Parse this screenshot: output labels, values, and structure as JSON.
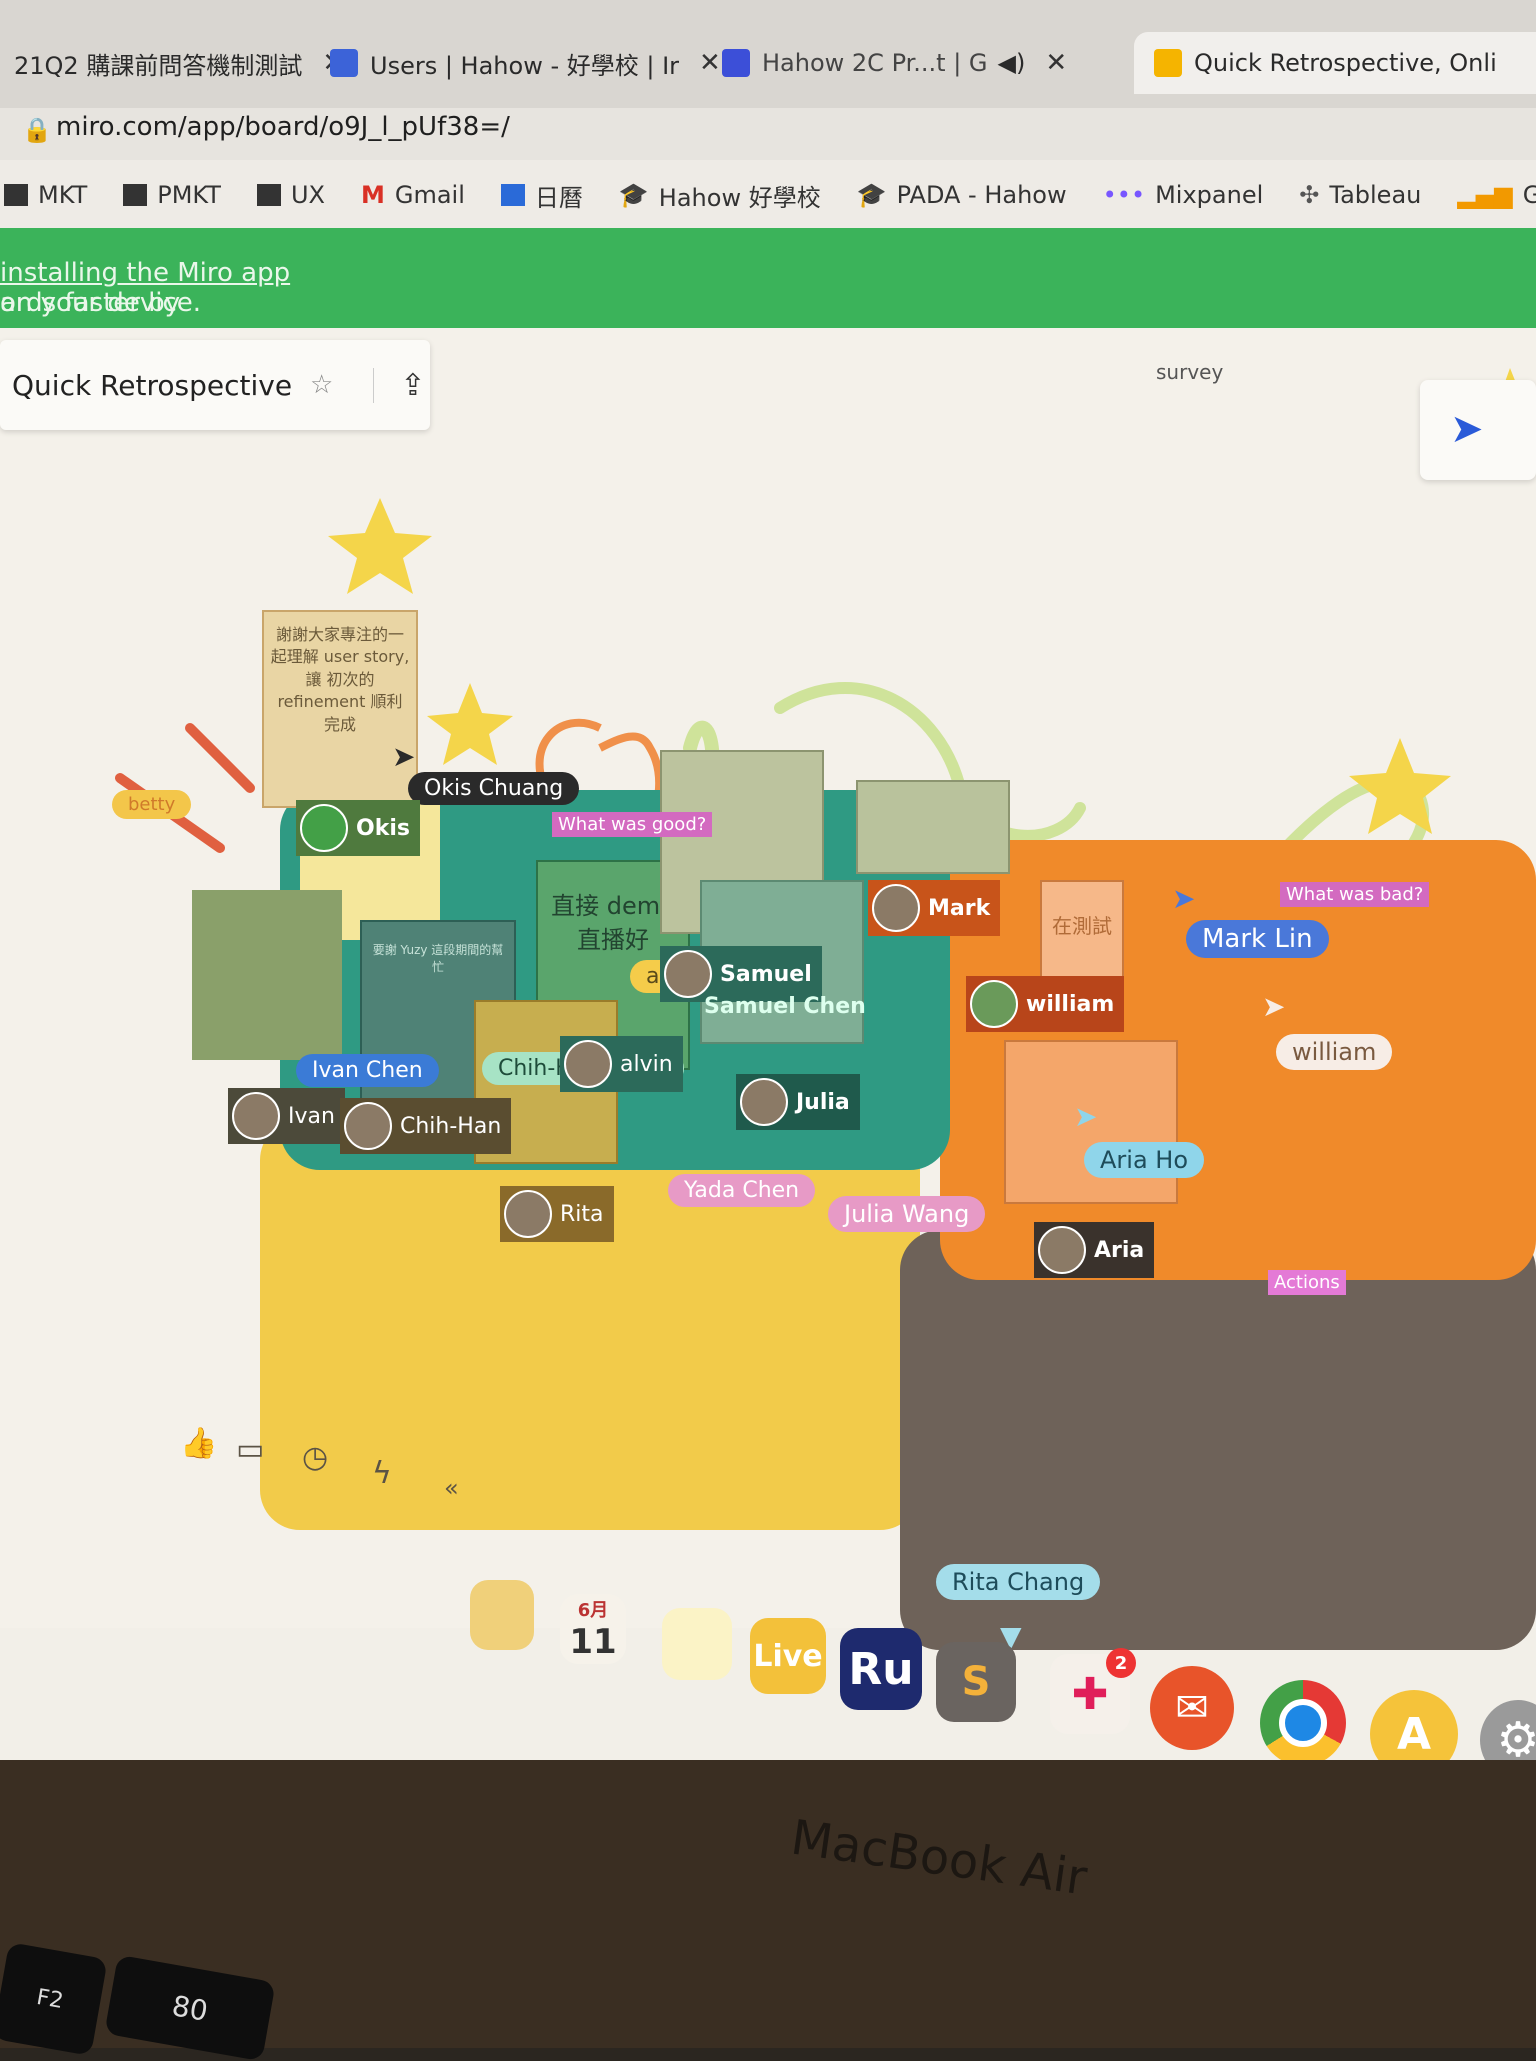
{
  "browser": {
    "tabs": [
      {
        "title": "21Q2 購課前問答機制測試"
      },
      {
        "title": "Users | Hahow - 好學校 | Ir"
      },
      {
        "title": "Hahow 2C Pr...t | G"
      },
      {
        "title": "Quick Retrospective, Onli"
      }
    ],
    "url": "miro.com/app/board/o9J_l_pUf38=/",
    "bookmarks": [
      "MKT",
      "PMKT",
      "UX",
      "Gmail",
      "日曆",
      "Hahow 好學校",
      "PADA - Hahow",
      "Mixpanel",
      "Tableau",
      "GA"
    ]
  },
  "banner": {
    "prefix": "ards faster by ",
    "link": "installing the Miro app",
    "suffix": " on your device."
  },
  "board": {
    "title": "Quick Retrospective",
    "survey_text": "survey",
    "sticky_top": "謝謝大家專注的一起理解 user story,讓 初次的 refinement 順利完成",
    "sticky_demo": "直接 demo 直播好",
    "sticky_testing": "在測試",
    "sticky_note_small": "要謝 Yuzy 這段期間的幫忙",
    "frame_labels": {
      "good": "What was good?",
      "bad": "What was bad?",
      "actions": "Actions"
    },
    "betty_label": "betty",
    "cursors": [
      {
        "name": "Okis Chuang",
        "color": "#2a2a2a"
      },
      {
        "name": "alvin",
        "color": "#f5cc4a"
      },
      {
        "name": "Ivan Chen",
        "color": "#3b7bd6"
      },
      {
        "name": "Chih-Han Wang",
        "color": "#a7e3c5"
      },
      {
        "name": "Mark Lin",
        "color": "#4a78d9"
      },
      {
        "name": "william",
        "color": "#f7ede6"
      },
      {
        "name": "Aria Ho",
        "color": "#8fd5ea"
      },
      {
        "name": "Yada Chen",
        "color": "#e79ac6"
      },
      {
        "name": "Julia Wang",
        "color": "#e79ac6"
      },
      {
        "name": "Rita Chang",
        "color": "#a4ddea"
      }
    ],
    "avatars": [
      "Okis",
      "Mark",
      "Samuel",
      "Samuel Chen",
      "Julia",
      "william",
      "Aria",
      "Ivan",
      "Chih-Han",
      "Rita",
      "alvin"
    ]
  },
  "dock": {
    "calendar_month": "6月",
    "calendar_day": "11",
    "live": "Live",
    "ru": "Ru",
    "slack_badge": "2"
  },
  "laptop": {
    "brand": "MacBook Air",
    "key_f2": "F2",
    "key_f3": "80"
  },
  "colors": {
    "frame_good": "#2f9a83",
    "frame_bad": "#f08a2a",
    "frame_yellow": "#f2cb4a",
    "frame_dark": "#6e6259",
    "banner": "#3bb35a"
  }
}
